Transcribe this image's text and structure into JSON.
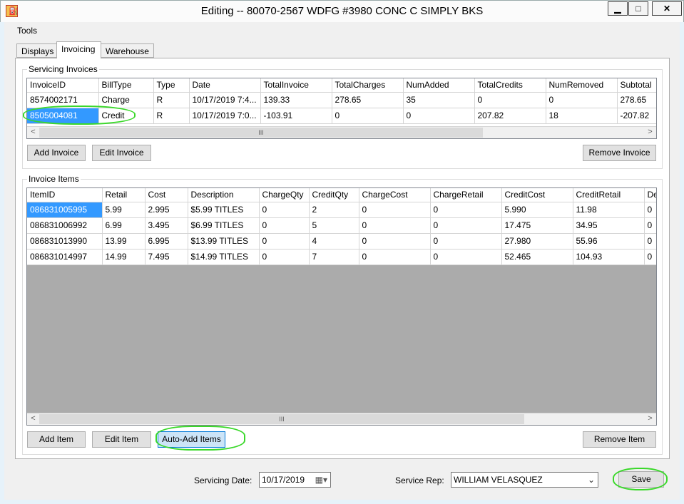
{
  "window": {
    "title": "Editing -- 80070-2567 WDFG #3980 CONC C SIMPLY BKS",
    "minimize": "▁",
    "maximize": "□",
    "close": "✕"
  },
  "menu": {
    "tools": "Tools"
  },
  "tabs": [
    "Displays",
    "Invoicing",
    "Warehouse"
  ],
  "servicing_invoices": {
    "label": "Servicing Invoices",
    "columns": [
      "InvoiceID",
      "BillType",
      "Type",
      "Date",
      "TotalInvoice",
      "TotalCharges",
      "NumAdded",
      "TotalCredits",
      "NumRemoved",
      "Subtotal"
    ],
    "rows": [
      [
        "8574002171",
        "Charge",
        "R",
        "10/17/2019 7:4...",
        "139.33",
        "278.65",
        "35",
        "0",
        "0",
        "278.65"
      ],
      [
        "8505004081",
        "Credit",
        "R",
        "10/17/2019 7:0...",
        "-103.91",
        "0",
        "0",
        "207.82",
        "18",
        "-207.82"
      ]
    ],
    "selected_row": 1
  },
  "invoice_buttons": {
    "add": "Add Invoice",
    "edit": "Edit Invoice",
    "remove": "Remove Invoice"
  },
  "invoice_items": {
    "label": "Invoice Items",
    "columns": [
      "ItemID",
      "Retail",
      "Cost",
      "Description",
      "ChargeQty",
      "CreditQty",
      "ChargeCost",
      "ChargeRetail",
      "CreditCost",
      "CreditRetail",
      "De"
    ],
    "rows": [
      [
        "086831005995",
        "5.99",
        "2.995",
        "$5.99 TITLES",
        "0",
        "2",
        "0",
        "0",
        "5.990",
        "11.98",
        "0"
      ],
      [
        "086831006992",
        "6.99",
        "3.495",
        "$6.99 TITLES",
        "0",
        "5",
        "0",
        "0",
        "17.475",
        "34.95",
        "0"
      ],
      [
        "086831013990",
        "13.99",
        "6.995",
        "$13.99 TITLES",
        "0",
        "4",
        "0",
        "0",
        "27.980",
        "55.96",
        "0"
      ],
      [
        "086831014997",
        "14.99",
        "7.495",
        "$14.99 TITLES",
        "0",
        "7",
        "0",
        "0",
        "52.465",
        "104.93",
        "0"
      ]
    ],
    "selected_row": 0
  },
  "item_buttons": {
    "add": "Add Item",
    "edit": "Edit Item",
    "auto_add": "Auto-Add Items",
    "remove": "Remove Item"
  },
  "bottom": {
    "servicing_date_label": "Servicing Date:",
    "servicing_date": "10/17/2019",
    "service_rep_label": "Service Rep:",
    "service_rep": "WILLIAM VELASQUEZ",
    "save": "Save"
  },
  "scroll": {
    "left": "<",
    "right": ">",
    "thumb": "III"
  },
  "icons": {
    "app": "app-icon",
    "calendar": "calendar-icon",
    "dropdown": "chevron-down-icon"
  },
  "colors": {
    "selection": "#3399ff",
    "annotation": "#3ad82a",
    "focus": "#cce4f7"
  }
}
